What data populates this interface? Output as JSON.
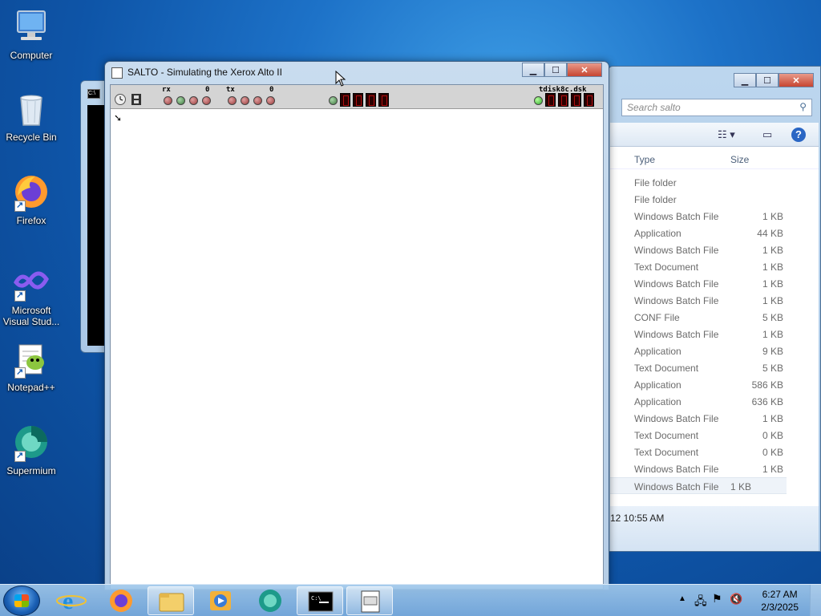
{
  "desktop": {
    "icons": [
      {
        "label": "Computer",
        "icon": "computer-icon"
      },
      {
        "label": "Recycle Bin",
        "icon": "recycle-bin-icon"
      },
      {
        "label": "Firefox",
        "icon": "firefox-icon"
      },
      {
        "label": "Microsoft Visual Stud...",
        "icon": "visual-studio-icon"
      },
      {
        "label": "Notepad++",
        "icon": "notepadpp-icon"
      },
      {
        "label": "Supermium",
        "icon": "supermium-icon"
      }
    ]
  },
  "explorer": {
    "search_placeholder": "Search salto",
    "columns": {
      "type": "Type",
      "size": "Size"
    },
    "rows": [
      {
        "type": "File folder",
        "size": ""
      },
      {
        "type": "File folder",
        "size": ""
      },
      {
        "type": "Windows Batch File",
        "size": "1 KB"
      },
      {
        "type": "Application",
        "size": "44 KB"
      },
      {
        "type": "Windows Batch File",
        "size": "1 KB"
      },
      {
        "type": "Text Document",
        "size": "1 KB"
      },
      {
        "type": "Windows Batch File",
        "size": "1 KB"
      },
      {
        "type": "Windows Batch File",
        "size": "1 KB"
      },
      {
        "type": "CONF File",
        "size": "5 KB"
      },
      {
        "type": "Windows Batch File",
        "size": "1 KB"
      },
      {
        "type": "Application",
        "size": "9 KB"
      },
      {
        "type": "Text Document",
        "size": "5 KB"
      },
      {
        "type": "Application",
        "size": "586 KB"
      },
      {
        "type": "Application",
        "size": "636 KB"
      },
      {
        "type": "Windows Batch File",
        "size": "1 KB"
      },
      {
        "type": "Text Document",
        "size": "0 KB"
      },
      {
        "type": "Text Document",
        "size": "0 KB"
      },
      {
        "type": "Windows Batch File",
        "size": "1 KB"
      },
      {
        "type": "Windows Batch File",
        "size": "1 KB"
      }
    ],
    "details_text": "12 10:55 AM"
  },
  "salto": {
    "title": "SALTO - Simulating the Xerox Alto II",
    "status": {
      "rx_label": "rx",
      "rx_count": "0",
      "tx_label": "tx",
      "tx_count": "0",
      "disk_label": "tdisk8c.dsk"
    }
  },
  "window_buttons": {
    "minimize": "▁",
    "maximize": "☐",
    "close": "✕"
  },
  "taskbar": {
    "items": [
      "start-button",
      "internet-explorer-icon",
      "firefox-icon",
      "file-explorer-icon",
      "media-player-icon",
      "supermium-icon",
      "cmd-icon",
      "salto-icon"
    ],
    "clock_time": "6:27 AM",
    "clock_date": "2/3/2025"
  },
  "colors": {
    "desktop": "#1d72c8",
    "taskbar": "#9cc4ea",
    "window_frame": "#b5cde6"
  }
}
